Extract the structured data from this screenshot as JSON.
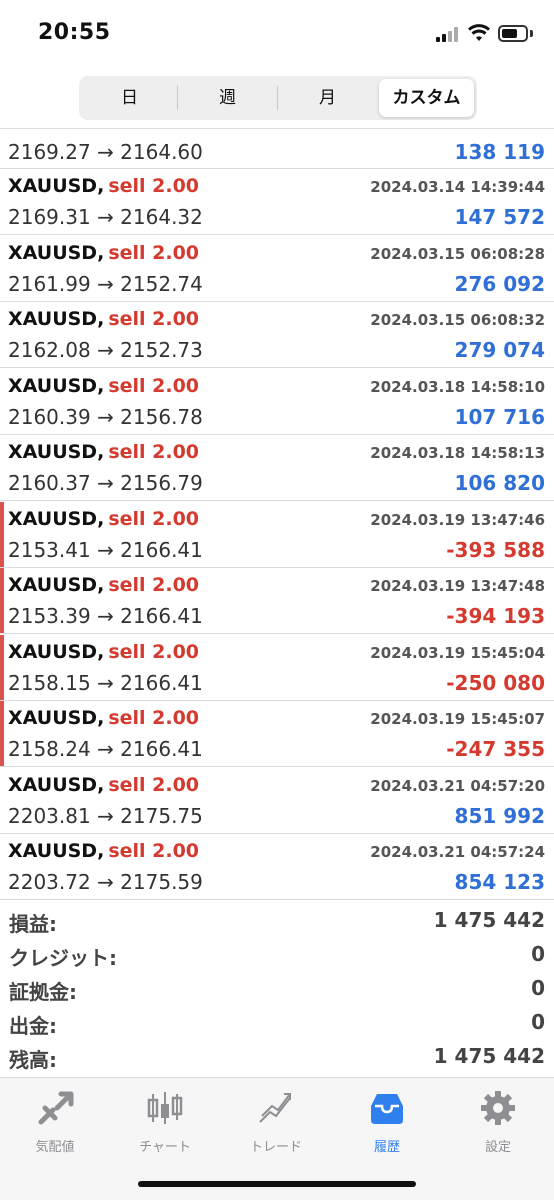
{
  "status": {
    "time": "20:55"
  },
  "segments": [
    {
      "label": "日",
      "active": false
    },
    {
      "label": "週",
      "active": false
    },
    {
      "label": "月",
      "active": false
    },
    {
      "label": "カスタム",
      "active": true
    }
  ],
  "partial_row": {
    "prices": "2169.27 → 2164.60",
    "profit": "138 119",
    "loss": false
  },
  "trades": [
    {
      "symbol": "XAUUSD,",
      "side": "sell 2.00",
      "time": "2024.03.14 14:39:44",
      "prices": "2169.31 → 2164.32",
      "profit": "147 572",
      "loss": false
    },
    {
      "symbol": "XAUUSD,",
      "side": "sell 2.00",
      "time": "2024.03.15 06:08:28",
      "prices": "2161.99 → 2152.74",
      "profit": "276 092",
      "loss": false
    },
    {
      "symbol": "XAUUSD,",
      "side": "sell 2.00",
      "time": "2024.03.15 06:08:32",
      "prices": "2162.08 → 2152.73",
      "profit": "279 074",
      "loss": false
    },
    {
      "symbol": "XAUUSD,",
      "side": "sell 2.00",
      "time": "2024.03.18 14:58:10",
      "prices": "2160.39 → 2156.78",
      "profit": "107 716",
      "loss": false
    },
    {
      "symbol": "XAUUSD,",
      "side": "sell 2.00",
      "time": "2024.03.18 14:58:13",
      "prices": "2160.37 → 2156.79",
      "profit": "106 820",
      "loss": false
    },
    {
      "symbol": "XAUUSD,",
      "side": "sell 2.00",
      "time": "2024.03.19 13:47:46",
      "prices": "2153.41 → 2166.41",
      "profit": "-393 588",
      "loss": true
    },
    {
      "symbol": "XAUUSD,",
      "side": "sell 2.00",
      "time": "2024.03.19 13:47:48",
      "prices": "2153.39 → 2166.41",
      "profit": "-394 193",
      "loss": true
    },
    {
      "symbol": "XAUUSD,",
      "side": "sell 2.00",
      "time": "2024.03.19 15:45:04",
      "prices": "2158.15 → 2166.41",
      "profit": "-250 080",
      "loss": true
    },
    {
      "symbol": "XAUUSD,",
      "side": "sell 2.00",
      "time": "2024.03.19 15:45:07",
      "prices": "2158.24 → 2166.41",
      "profit": "-247 355",
      "loss": true
    },
    {
      "symbol": "XAUUSD,",
      "side": "sell 2.00",
      "time": "2024.03.21 04:57:20",
      "prices": "2203.81 → 2175.75",
      "profit": "851 992",
      "loss": false
    },
    {
      "symbol": "XAUUSD,",
      "side": "sell 2.00",
      "time": "2024.03.21 04:57:24",
      "prices": "2203.72 → 2175.59",
      "profit": "854 123",
      "loss": false
    }
  ],
  "summary": [
    {
      "label": "損益:",
      "value": "1 475 442"
    },
    {
      "label": "クレジット:",
      "value": "0"
    },
    {
      "label": "証拠金:",
      "value": "0"
    },
    {
      "label": "出金:",
      "value": "0"
    },
    {
      "label": "残高:",
      "value": "1 475 442"
    }
  ],
  "tabs": [
    {
      "label": "気配値",
      "icon": "quotes-icon",
      "active": false
    },
    {
      "label": "チャート",
      "icon": "chart-icon",
      "active": false
    },
    {
      "label": "トレード",
      "icon": "trade-icon",
      "active": false
    },
    {
      "label": "履歴",
      "icon": "history-icon",
      "active": true
    },
    {
      "label": "設定",
      "icon": "settings-icon",
      "active": false
    }
  ],
  "colors": {
    "profit": "#2f6fd6",
    "loss": "#d43a2f",
    "active_tab": "#2f80ed",
    "inactive_tab": "#8e8e93"
  }
}
